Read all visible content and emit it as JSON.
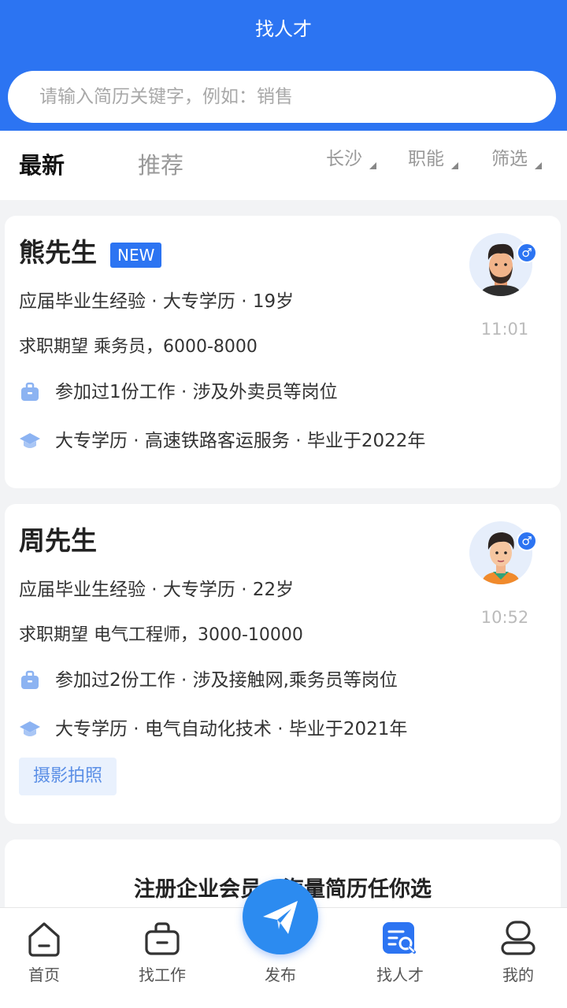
{
  "header": {
    "title": "找人才",
    "search_placeholder": "请输入简历关键字，例如：销售"
  },
  "tabs": {
    "latest": "最新",
    "recommend": "推荐"
  },
  "filters": {
    "city": "长沙",
    "function": "职能",
    "screen": "筛选"
  },
  "candidates": [
    {
      "name": "熊先生",
      "badge": "NEW",
      "info": "应届毕业生经验 · 大专学历 · 19岁",
      "expect": "求职期望 乘务员，6000-8000",
      "work": "参加过1份工作 · 涉及外卖员等岗位",
      "edu": "大专学历 · 高速铁路客运服务 · 毕业于2022年",
      "time": "11:01",
      "gender": "♂"
    },
    {
      "name": "周先生",
      "info": "应届毕业生经验 · 大专学历 · 22岁",
      "expect": "求职期望 电气工程师，3000-10000",
      "work": "参加过2份工作 · 涉及接触网,乘务员等岗位",
      "edu": "大专学历 · 电气自动化技术 · 毕业于2021年",
      "time": "10:52",
      "gender": "♂",
      "tag": "摄影拍照"
    }
  ],
  "promo": "注册企业会员，海量简历任你选",
  "nav": {
    "home": "首页",
    "job": "找工作",
    "post": "发布",
    "talent": "找人才",
    "mine": "我的"
  },
  "colors": {
    "primary": "#2c74f2",
    "tag_bg": "#e9f1fd"
  }
}
